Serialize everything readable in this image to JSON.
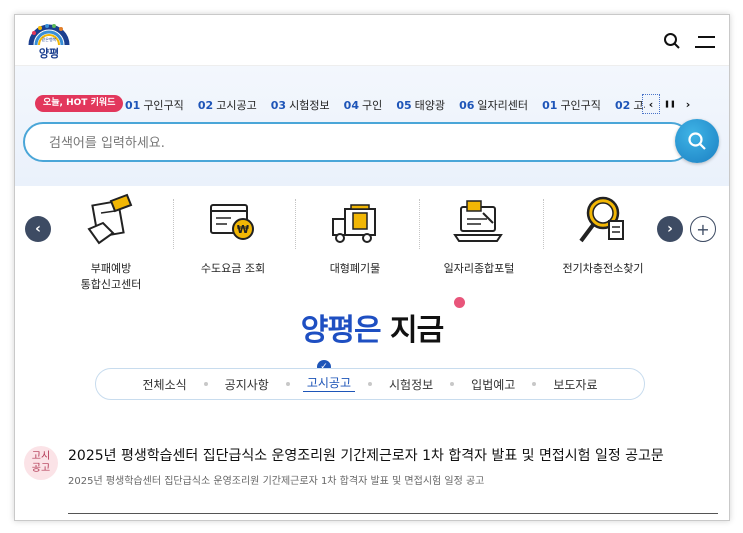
{
  "header": {
    "logo_text": "양평",
    "logo_small": "같은행복",
    "search_icon": "search-icon",
    "menu_icon": "hamburger-menu-icon"
  },
  "hot": {
    "badge": "오늘, HOT 키워드",
    "keywords": [
      {
        "num": "01",
        "label": "구인구직"
      },
      {
        "num": "02",
        "label": "고시공고"
      },
      {
        "num": "03",
        "label": "시험정보"
      },
      {
        "num": "04",
        "label": "구인"
      },
      {
        "num": "05",
        "label": "태양광"
      },
      {
        "num": "06",
        "label": "일자리센터"
      },
      {
        "num": "01",
        "label": "구인구직"
      },
      {
        "num": "02",
        "label": "고시공고"
      }
    ],
    "prev": "‹",
    "pause": "❚❚",
    "next": "›"
  },
  "search": {
    "placeholder": "검색어를 입력하세요."
  },
  "quick_menu": {
    "prev": "‹",
    "next": "›",
    "plus": "+",
    "items": [
      {
        "label": "부패예방",
        "label2": "통합신고센터",
        "icon": "report-form-pen-icon"
      },
      {
        "label": "수도요금 조회",
        "label2": "",
        "icon": "water-bill-won-icon"
      },
      {
        "label": "대형폐기물",
        "label2": "",
        "icon": "garbage-truck-bin-icon"
      },
      {
        "label": "일자리종합포털",
        "label2": "",
        "icon": "job-portal-laptop-icon"
      },
      {
        "label": "전기차충전소찾기",
        "label2": "",
        "icon": "ev-charger-magnifier-icon"
      }
    ]
  },
  "now": {
    "title_a": "양평은",
    "title_b": "지금",
    "check": "✓",
    "tabs": [
      {
        "label": "전체소식",
        "active": false
      },
      {
        "label": "공지사항",
        "active": false
      },
      {
        "label": "고시공고",
        "active": true
      },
      {
        "label": "시험정보",
        "active": false
      },
      {
        "label": "입법예고",
        "active": false
      },
      {
        "label": "보도자료",
        "active": false
      }
    ]
  },
  "article": {
    "badge_line1": "고시",
    "badge_line2": "공고",
    "title": "2025년 평생학습센터 집단급식소 운영조리원 기간제근로자 1차 합격자 발표 및 면접시험 일정 공고문",
    "subtitle": "2025년 평생학습센터 집단급식소 운영조리원 기간제근로자 1차 합격자 발표 및 면접시험 일정 공고"
  },
  "colors": {
    "accent": "#1e55b8",
    "hot": "#e2375c",
    "search_border": "#4aa6d8"
  }
}
